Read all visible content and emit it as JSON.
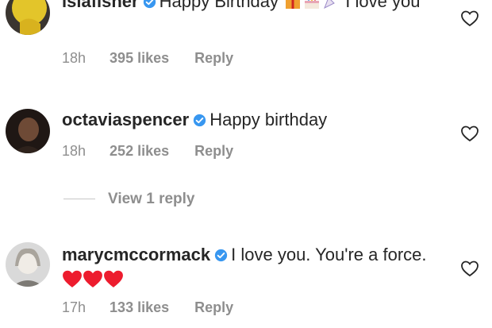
{
  "comments": [
    {
      "username": "islafisher",
      "text_before": "Happy Birthday",
      "text_after": "I love you",
      "emoji_names": [
        "gift-emoji",
        "cake-emoji",
        "party-popper-emoji"
      ],
      "time": "18h",
      "likes": "395 likes",
      "reply": "Reply",
      "avatar_color": "#e3c52a"
    },
    {
      "username": "octaviaspencer",
      "text": "Happy birthday",
      "time": "18h",
      "likes": "252 likes",
      "reply": "Reply",
      "avatar_color": "#2b1e1a"
    },
    {
      "username": "marycmccormack",
      "text": "I love you.  You're a force.",
      "emoji_names": [
        "red-heart-emoji",
        "red-heart-emoji",
        "red-heart-emoji"
      ],
      "time": "17h",
      "likes": "133 likes",
      "reply": "Reply",
      "avatar_color": "#bfbfbf"
    }
  ],
  "view_replies": "View 1 reply",
  "colors": {
    "verified": "#3897f0",
    "meta": "#8e8e8e",
    "text": "#262626",
    "heart_emoji": "#ed1c2e"
  },
  "icons": [
    "verified-badge-icon",
    "heart-outline-icon"
  ]
}
